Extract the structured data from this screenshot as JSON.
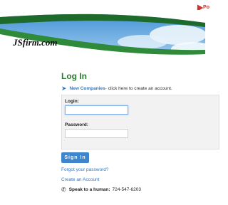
{
  "header": {
    "powered_text": "Po",
    "powered_icon": "arrow-flag-icon",
    "logo_text": "JSfirm.com",
    "brand_green": "#2b7a2f",
    "accent_red": "#d2312b"
  },
  "login": {
    "title": "Log In",
    "promo_icon": "paper-plane-icon",
    "promo_link": "New Companies",
    "promo_text": " - click here to create an account.",
    "login_label": "Login:",
    "login_value": "",
    "password_label": "Password:",
    "password_value": "",
    "signin_label": "Sign In",
    "forgot_link": "Forgot your password?",
    "create_link": "Create an Account",
    "phone_icon": "phone-icon",
    "phone_label": "Speak to a human:",
    "phone_number": "724-547-6203",
    "link_color": "#2f77c2",
    "button_color": "#3e85cc"
  }
}
